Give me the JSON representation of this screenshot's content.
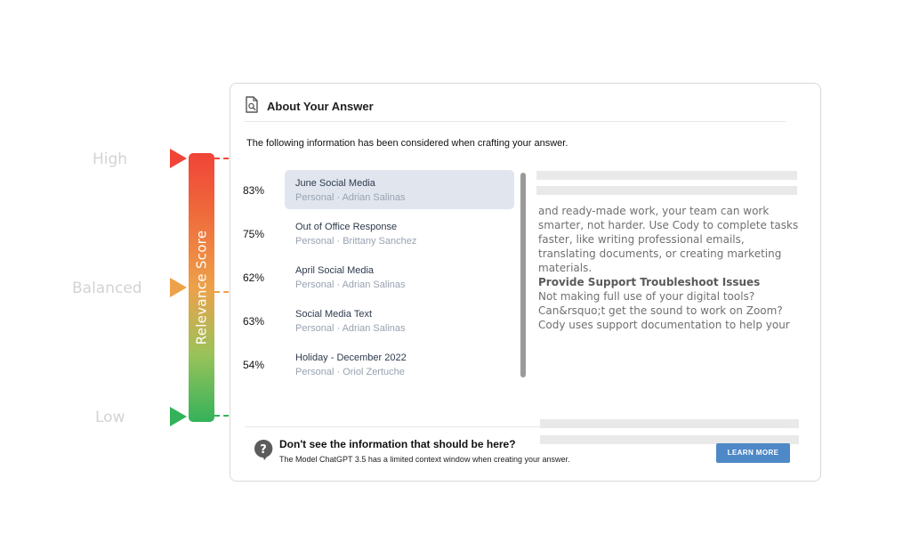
{
  "scale": {
    "title": "Relevance Score",
    "levels": [
      "High",
      "Balanced",
      "Low"
    ],
    "colors": {
      "high": "#f04438",
      "balanced": "#eda14a",
      "low": "#34b25a"
    }
  },
  "panel": {
    "title": "About Your Answer",
    "intro": "The following information has been considered when crafting your answer.",
    "items": [
      {
        "score": "83%",
        "title": "June Social Media",
        "subtitle": "Personal · Adrian Salinas",
        "selected": true
      },
      {
        "score": "75%",
        "title": "Out of Office Response",
        "subtitle": "Personal · Brittany Sanchez",
        "selected": false
      },
      {
        "score": "62%",
        "title": "April Social Media",
        "subtitle": "Personal · Adrian Salinas",
        "selected": false
      },
      {
        "score": "63%",
        "title": "Social Media Text",
        "subtitle": "Personal · Adrian Salinas",
        "selected": false
      },
      {
        "score": "54%",
        "title": "Holiday - December 2022",
        "subtitle": "Personal · Oriol Zertuche",
        "selected": false
      }
    ],
    "preview": {
      "paragraph_1": "and ready-made work, your team can work smarter, not harder. Use Cody to complete tasks faster, like writing professional emails, translating documents, or creating marketing materials.",
      "heading": "Provide Support Troubleshoot Issues",
      "paragraph_2": "Not making full use of your digital tools? Can&rsquo;t get the sound to work on Zoom? Cody uses support documentation to help your"
    }
  },
  "footer": {
    "title": "Don't see the information that should be here?",
    "subtitle": "The Model ChatGPT 3.5 has a limited context window when creating your answer.",
    "button": "LEARN MORE"
  },
  "icons": {
    "header": "document-search-icon",
    "footer": "question-bubble-icon"
  },
  "colors": {
    "accent": "#4e88c7",
    "selected_row": "#e1e6ee"
  }
}
